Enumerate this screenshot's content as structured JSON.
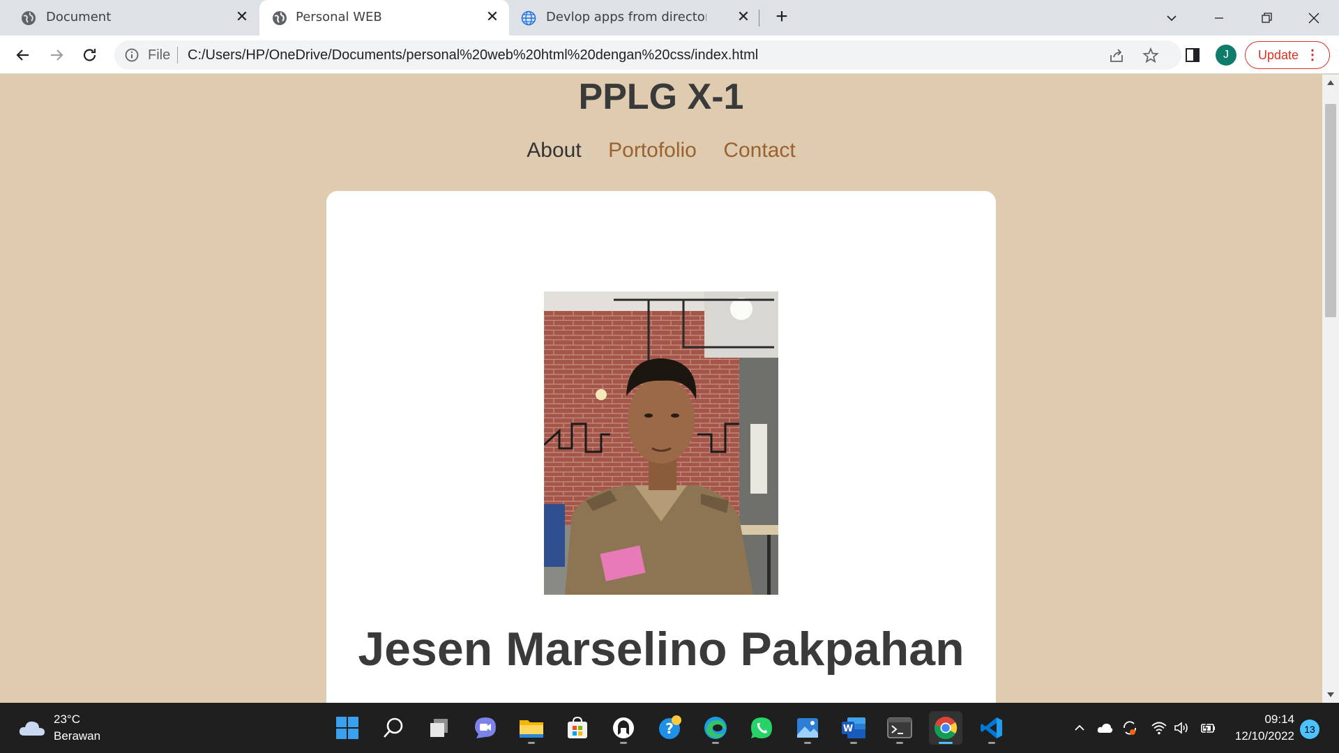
{
  "browser": {
    "tabs": [
      {
        "title": "Document",
        "active": false
      },
      {
        "title": "Personal WEB",
        "active": true
      },
      {
        "title": "Devlop apps from directory→gith",
        "active": false
      }
    ],
    "address": {
      "scheme_label": "File",
      "url": "C:/Users/HP/OneDrive/Documents/personal%20web%20html%20dengan%20css/index.html"
    },
    "profile_initial": "J",
    "update_label": "Update",
    "menu_glyph": "⋮"
  },
  "page": {
    "site_title": "PPLG X-1",
    "nav": [
      {
        "label": "About",
        "current": true
      },
      {
        "label": "Portofolio",
        "current": false
      },
      {
        "label": "Contact",
        "current": false
      }
    ],
    "person_name": "Jesen Marselino Pakpahan",
    "colors": {
      "background": "#dfcbb0",
      "card": "#ffffff",
      "nav_link": "#99622f",
      "text": "#3a3a3a"
    }
  },
  "taskbar": {
    "weather": {
      "temp": "23°C",
      "desc": "Berawan",
      "icon": "cloud-icon"
    },
    "apps": [
      "start-icon",
      "search-icon",
      "task-view-icon",
      "teams-chat-icon",
      "file-explorer-icon",
      "microsoft-store-icon",
      "github-desktop-icon",
      "get-help-icon",
      "edge-icon",
      "whatsapp-icon",
      "photos-icon",
      "word-icon",
      "terminal-icon",
      "chrome-icon",
      "vscode-icon"
    ],
    "clock": {
      "time": "09:14",
      "date": "12/10/2022"
    },
    "notifications": "13"
  }
}
